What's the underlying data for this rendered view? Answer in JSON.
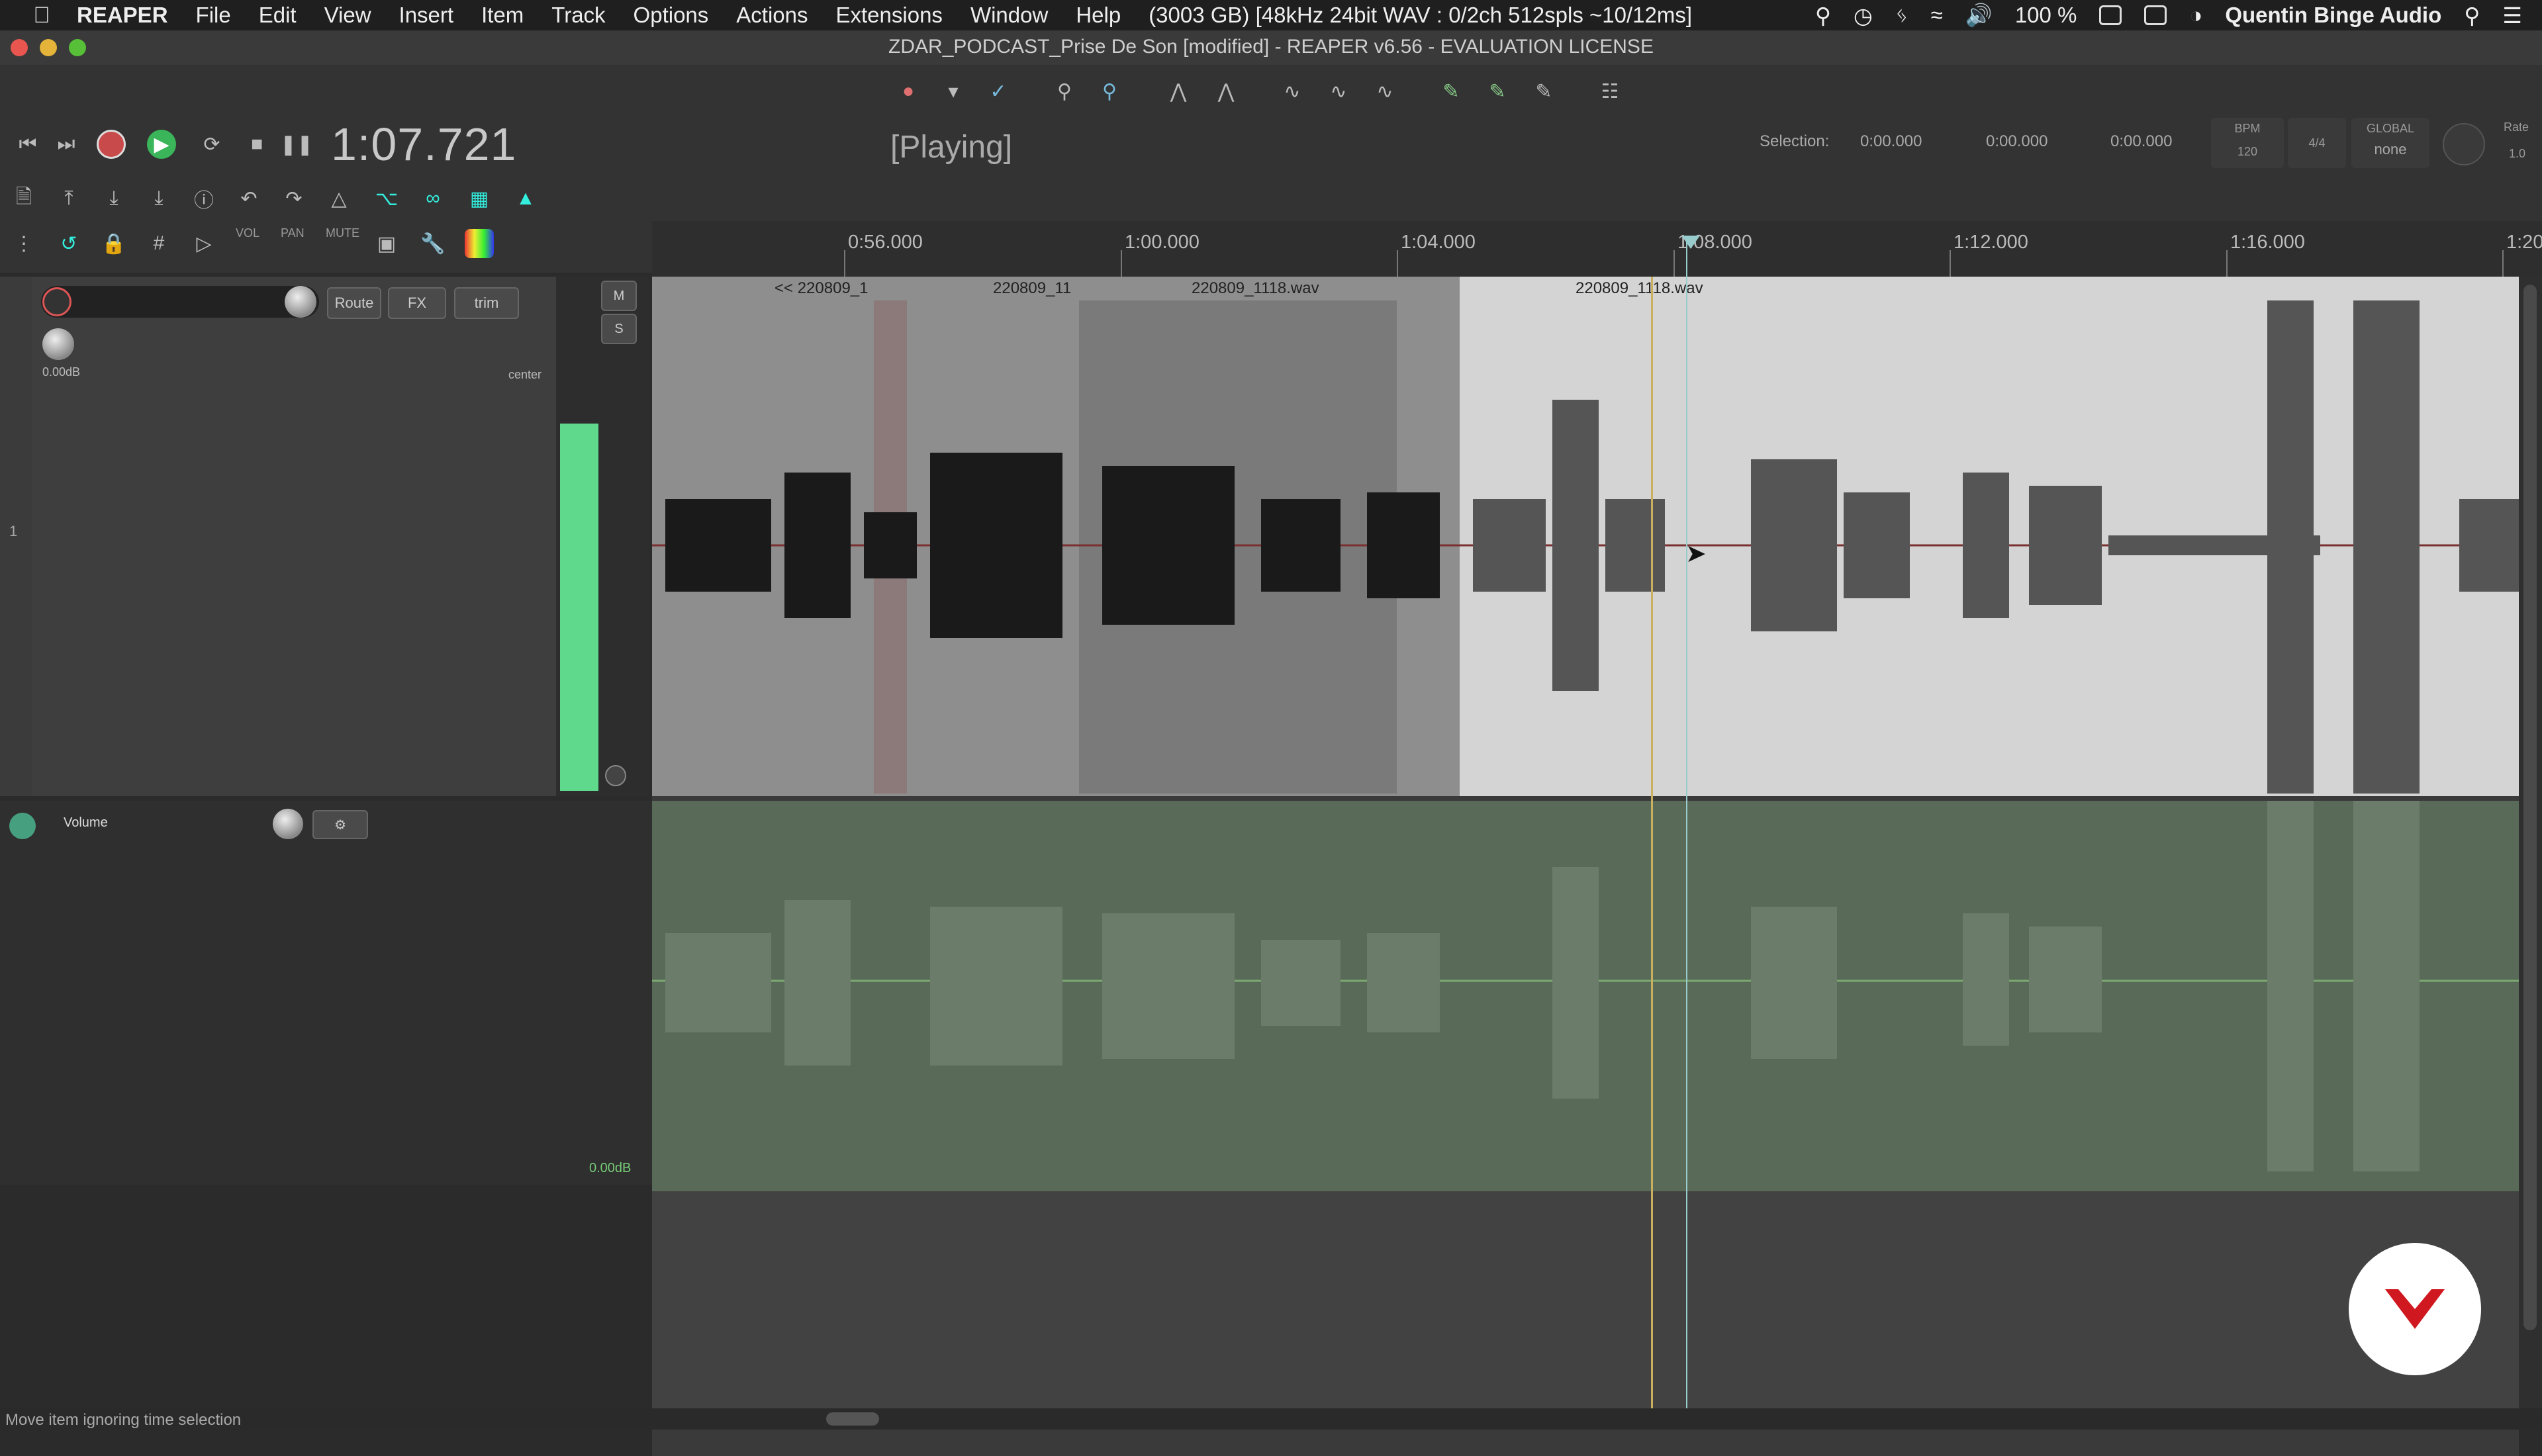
{
  "menubar": {
    "app": "REAPER",
    "items": [
      "File",
      "Edit",
      "View",
      "Insert",
      "Item",
      "Track",
      "Options",
      "Actions",
      "Extensions",
      "Window",
      "Help"
    ],
    "status": "(3003 GB) [48kHz 24bit WAV : 0/2ch 512spls ~10/12ms]",
    "battery": "100 %",
    "user": "Quentin Binge Audio"
  },
  "window": {
    "title": "ZDAR_PODCAST_Prise De Son [modified] - REAPER v6.56 - EVALUATION LICENSE"
  },
  "transport": {
    "time": "1:07.721",
    "state": "[Playing]",
    "selection_label": "Selection:",
    "sel_start": "0:00.000",
    "sel_end": "0:00.000",
    "sel_len": "0:00.000",
    "bpm_label": "BPM",
    "bpm": "120",
    "timesig": "4/4",
    "global_label": "GLOBAL",
    "global_value": "none",
    "rate_label": "Rate",
    "rate": "1.0"
  },
  "toolbar": {
    "vol": "VOL",
    "pan": "PAN",
    "mute": "MUTE"
  },
  "ruler": {
    "labels": [
      "0:56.000",
      "1:00.000",
      "1:04.000",
      "1:08.000",
      "1:12.000",
      "1:16.000",
      "1:20"
    ]
  },
  "track": {
    "number": "1",
    "route": "Route",
    "fx": "FX",
    "trim": "trim",
    "vol_db": "0.00dB",
    "pan": "center",
    "m": "M",
    "s": "S"
  },
  "items": [
    {
      "name": "<< 220809_1"
    },
    {
      "name": "220809_11"
    },
    {
      "name": "220809_1118.wav"
    },
    {
      "name": "220809_1118.wav"
    }
  ],
  "envelope": {
    "label": "Volume",
    "db": "0.00dB"
  },
  "status": "Move item ignoring time selection"
}
